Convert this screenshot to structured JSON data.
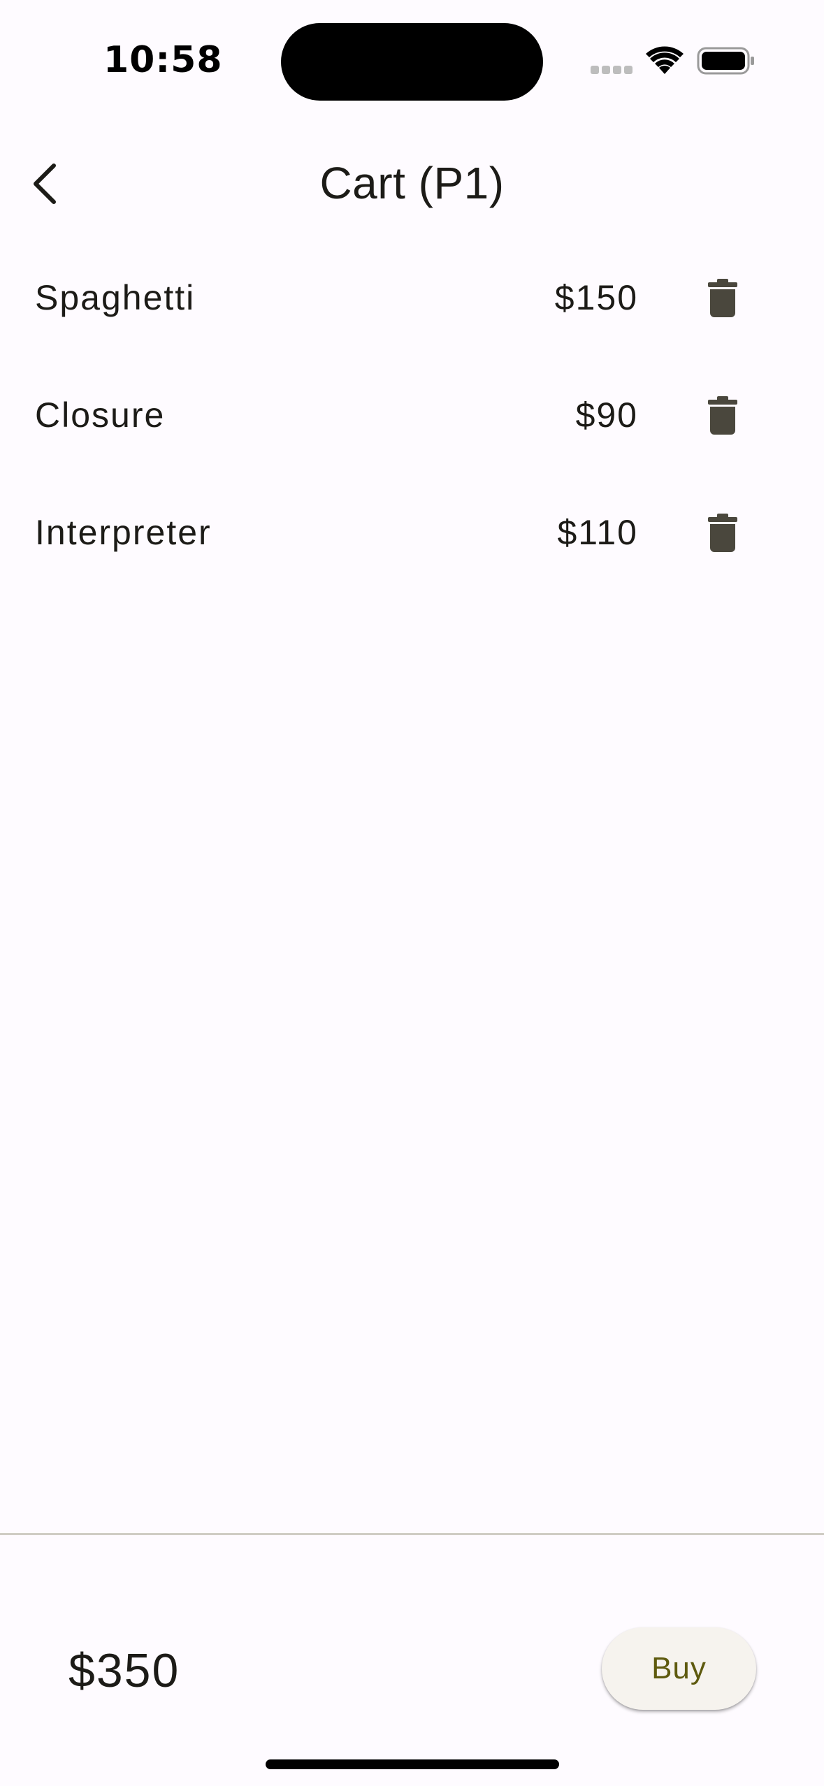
{
  "status_bar": {
    "time": "10:58"
  },
  "header": {
    "title": "Cart (P1)",
    "back_icon": "chevron-left-icon"
  },
  "cart": {
    "items": [
      {
        "name": "Spaghetti",
        "price": "$150",
        "delete_icon": "trash-icon"
      },
      {
        "name": "Closure",
        "price": "$90",
        "delete_icon": "trash-icon"
      },
      {
        "name": "Interpreter",
        "price": "$110",
        "delete_icon": "trash-icon"
      }
    ]
  },
  "footer": {
    "total": "$350",
    "buy_label": "Buy"
  },
  "colors": {
    "background": "#FEFBFF",
    "icon": "#4A473D",
    "buy_button_bg": "#F6F3EE",
    "buy_button_text": "#5E5A0E",
    "divider": "#CFCCC4"
  }
}
